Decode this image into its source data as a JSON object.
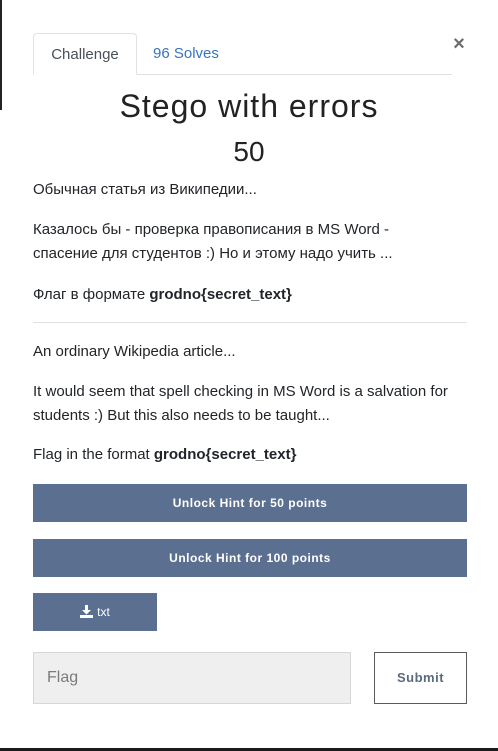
{
  "tabs": [
    {
      "label": "Challenge"
    },
    {
      "label": "96 Solves"
    }
  ],
  "close_label": "×",
  "challenge": {
    "title": "Stego with errors",
    "points": "50"
  },
  "description": {
    "ru_p1": "Обычная статья из Википедии...",
    "ru_p2_line1": "Казалось бы - проверка правописания в MS Word -",
    "ru_p2_line2": "спасение для студентов :) Но и этому надо учить ...",
    "ru_p3_prefix": "Флаг в формате ",
    "ru_p3_flag": "grodno{secret_text}",
    "en_p1": "An ordinary Wikipedia article...",
    "en_p2_line1": "It would seem that spell checking in MS Word is a salvation for",
    "en_p2_line2": "students :) But this also needs to be taught...",
    "en_p3_prefix": "Flag in the format ",
    "en_p3_flag": "grodno{secret_text}"
  },
  "hints": [
    {
      "label": "Unlock Hint for 50 points"
    },
    {
      "label": "Unlock Hint for 100 points"
    }
  ],
  "file": {
    "label": "txt",
    "icon": "download-icon"
  },
  "flag_form": {
    "placeholder": "Flag",
    "value": "",
    "submit_label": "Submit"
  }
}
